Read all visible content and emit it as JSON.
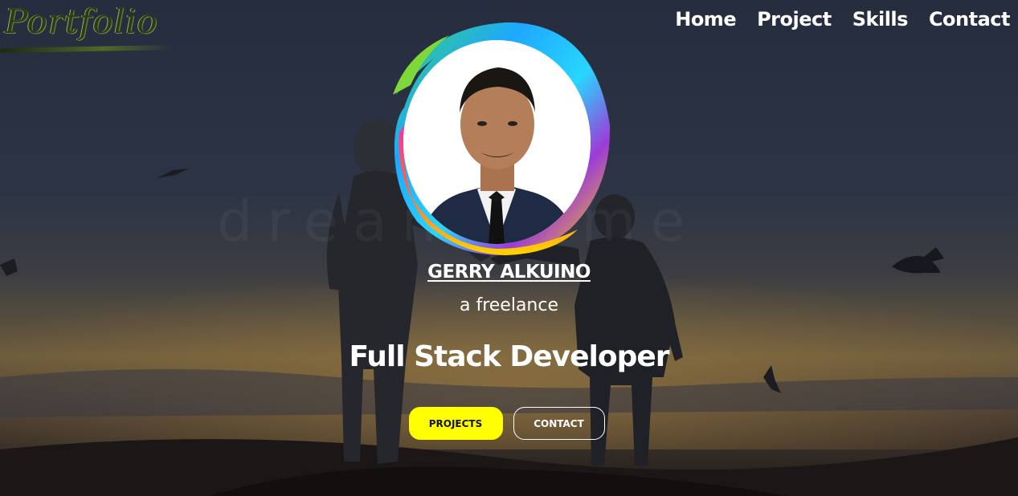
{
  "logo": {
    "text": "Portfolio"
  },
  "nav": {
    "items": [
      {
        "label": "Home"
      },
      {
        "label": "Project"
      },
      {
        "label": "Skills"
      },
      {
        "label": "Contact"
      }
    ]
  },
  "hero": {
    "name": "GERRY ALKUINO",
    "tagline": "a freelance",
    "role": "Full Stack Developer",
    "projects_button": "PROJECTS",
    "contact_button": "CONTACT"
  },
  "colors": {
    "accent": "#ffff00",
    "text": "#ffffff"
  }
}
